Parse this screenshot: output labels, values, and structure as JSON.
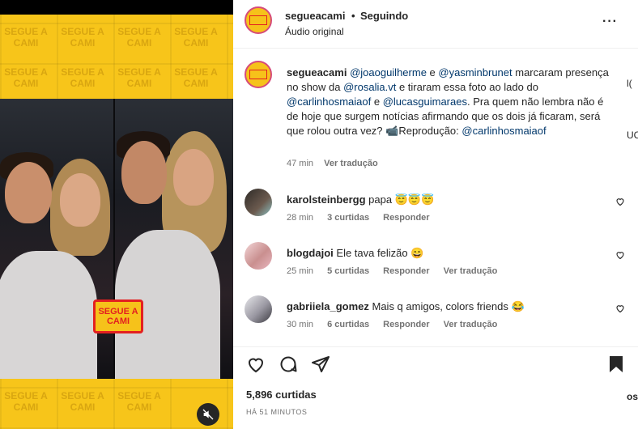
{
  "post": {
    "username": "segueacami",
    "follow_status": "Seguindo",
    "audio": "Áudio original",
    "logo_text": "SEGUE A CAMI",
    "caption": {
      "segments": [
        {
          "t": "@joaoguilherme",
          "m": true
        },
        {
          "t": " e ",
          "m": false
        },
        {
          "t": "@yasminbrunet",
          "m": true
        },
        {
          "t": " marcaram presença no show da ",
          "m": false
        },
        {
          "t": "@rosalia.vt",
          "m": true
        },
        {
          "t": " e tiraram essa foto ao lado do ",
          "m": false
        },
        {
          "t": "@carlinhosmaiaof",
          "m": true
        },
        {
          "t": " e ",
          "m": false
        },
        {
          "t": "@lucasguimaraes",
          "m": true
        },
        {
          "t": ". Pra quem não lembra não é de hoje que surgem notícias afirmando que os dois já ficaram, será que rolou outra vez? ",
          "m": false
        },
        {
          "t": "📹Reprodução: ",
          "m": false
        },
        {
          "t": "@carlinhosmaiaof",
          "m": true
        }
      ],
      "time": "47 min",
      "translate": "Ver tradução"
    },
    "comments": [
      {
        "user": "karolsteinbergg",
        "text": "papa 😇😇😇",
        "time": "28 min",
        "likes": "3 curtidas",
        "reply": "Responder",
        "translate": ""
      },
      {
        "user": "blogdajoi",
        "text": "Ele tava felizão 😄",
        "time": "25 min",
        "likes": "5 curtidas",
        "reply": "Responder",
        "translate": "Ver tradução"
      },
      {
        "user": "gabriiela_gomez",
        "text": "Mais q amigos, colors friends 😂",
        "time": "30 min",
        "likes": "6 curtidas",
        "reply": "Responder",
        "translate": "Ver tradução"
      }
    ],
    "like_count": "5,896 curtidas",
    "time_ago": "HÁ 51 MINUTOS"
  },
  "edge": {
    "a": "l(",
    "b": "UC",
    "c": "os"
  },
  "colors": {
    "mention": "#00376b",
    "muted": "#737373",
    "brand_yellow": "#f6c21a",
    "brand_red": "#e32020"
  }
}
